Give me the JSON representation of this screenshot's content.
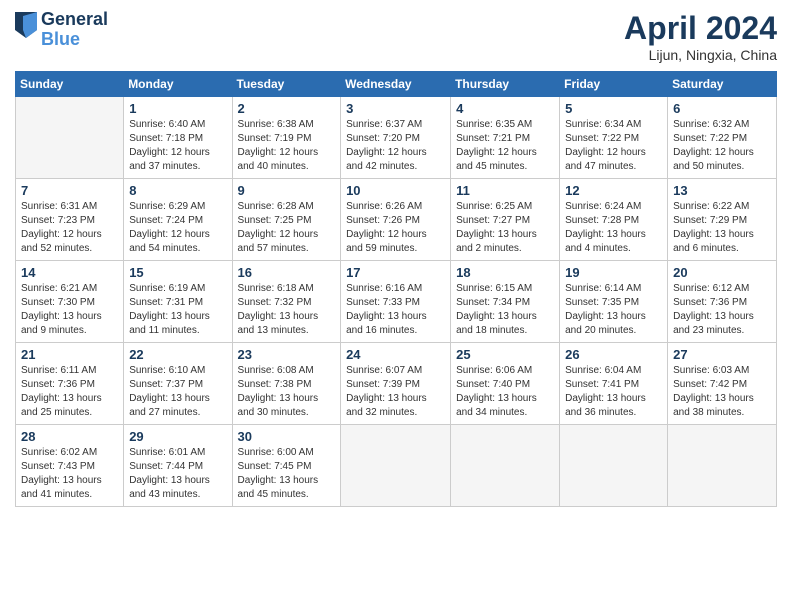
{
  "logo": {
    "line1": "General",
    "line2": "Blue"
  },
  "title": "April 2024",
  "location": "Lijun, Ningxia, China",
  "header_days": [
    "Sunday",
    "Monday",
    "Tuesday",
    "Wednesday",
    "Thursday",
    "Friday",
    "Saturday"
  ],
  "weeks": [
    [
      {
        "day": null
      },
      {
        "day": "1",
        "sunrise": "6:40 AM",
        "sunset": "7:18 PM",
        "daylight": "12 hours and 37 minutes."
      },
      {
        "day": "2",
        "sunrise": "6:38 AM",
        "sunset": "7:19 PM",
        "daylight": "12 hours and 40 minutes."
      },
      {
        "day": "3",
        "sunrise": "6:37 AM",
        "sunset": "7:20 PM",
        "daylight": "12 hours and 42 minutes."
      },
      {
        "day": "4",
        "sunrise": "6:35 AM",
        "sunset": "7:21 PM",
        "daylight": "12 hours and 45 minutes."
      },
      {
        "day": "5",
        "sunrise": "6:34 AM",
        "sunset": "7:22 PM",
        "daylight": "12 hours and 47 minutes."
      },
      {
        "day": "6",
        "sunrise": "6:32 AM",
        "sunset": "7:22 PM",
        "daylight": "12 hours and 50 minutes."
      }
    ],
    [
      {
        "day": "7",
        "sunrise": "6:31 AM",
        "sunset": "7:23 PM",
        "daylight": "12 hours and 52 minutes."
      },
      {
        "day": "8",
        "sunrise": "6:29 AM",
        "sunset": "7:24 PM",
        "daylight": "12 hours and 54 minutes."
      },
      {
        "day": "9",
        "sunrise": "6:28 AM",
        "sunset": "7:25 PM",
        "daylight": "12 hours and 57 minutes."
      },
      {
        "day": "10",
        "sunrise": "6:26 AM",
        "sunset": "7:26 PM",
        "daylight": "12 hours and 59 minutes."
      },
      {
        "day": "11",
        "sunrise": "6:25 AM",
        "sunset": "7:27 PM",
        "daylight": "13 hours and 2 minutes."
      },
      {
        "day": "12",
        "sunrise": "6:24 AM",
        "sunset": "7:28 PM",
        "daylight": "13 hours and 4 minutes."
      },
      {
        "day": "13",
        "sunrise": "6:22 AM",
        "sunset": "7:29 PM",
        "daylight": "13 hours and 6 minutes."
      }
    ],
    [
      {
        "day": "14",
        "sunrise": "6:21 AM",
        "sunset": "7:30 PM",
        "daylight": "13 hours and 9 minutes."
      },
      {
        "day": "15",
        "sunrise": "6:19 AM",
        "sunset": "7:31 PM",
        "daylight": "13 hours and 11 minutes."
      },
      {
        "day": "16",
        "sunrise": "6:18 AM",
        "sunset": "7:32 PM",
        "daylight": "13 hours and 13 minutes."
      },
      {
        "day": "17",
        "sunrise": "6:16 AM",
        "sunset": "7:33 PM",
        "daylight": "13 hours and 16 minutes."
      },
      {
        "day": "18",
        "sunrise": "6:15 AM",
        "sunset": "7:34 PM",
        "daylight": "13 hours and 18 minutes."
      },
      {
        "day": "19",
        "sunrise": "6:14 AM",
        "sunset": "7:35 PM",
        "daylight": "13 hours and 20 minutes."
      },
      {
        "day": "20",
        "sunrise": "6:12 AM",
        "sunset": "7:36 PM",
        "daylight": "13 hours and 23 minutes."
      }
    ],
    [
      {
        "day": "21",
        "sunrise": "6:11 AM",
        "sunset": "7:36 PM",
        "daylight": "13 hours and 25 minutes."
      },
      {
        "day": "22",
        "sunrise": "6:10 AM",
        "sunset": "7:37 PM",
        "daylight": "13 hours and 27 minutes."
      },
      {
        "day": "23",
        "sunrise": "6:08 AM",
        "sunset": "7:38 PM",
        "daylight": "13 hours and 30 minutes."
      },
      {
        "day": "24",
        "sunrise": "6:07 AM",
        "sunset": "7:39 PM",
        "daylight": "13 hours and 32 minutes."
      },
      {
        "day": "25",
        "sunrise": "6:06 AM",
        "sunset": "7:40 PM",
        "daylight": "13 hours and 34 minutes."
      },
      {
        "day": "26",
        "sunrise": "6:04 AM",
        "sunset": "7:41 PM",
        "daylight": "13 hours and 36 minutes."
      },
      {
        "day": "27",
        "sunrise": "6:03 AM",
        "sunset": "7:42 PM",
        "daylight": "13 hours and 38 minutes."
      }
    ],
    [
      {
        "day": "28",
        "sunrise": "6:02 AM",
        "sunset": "7:43 PM",
        "daylight": "13 hours and 41 minutes."
      },
      {
        "day": "29",
        "sunrise": "6:01 AM",
        "sunset": "7:44 PM",
        "daylight": "13 hours and 43 minutes."
      },
      {
        "day": "30",
        "sunrise": "6:00 AM",
        "sunset": "7:45 PM",
        "daylight": "13 hours and 45 minutes."
      },
      {
        "day": null
      },
      {
        "day": null
      },
      {
        "day": null
      },
      {
        "day": null
      }
    ]
  ]
}
